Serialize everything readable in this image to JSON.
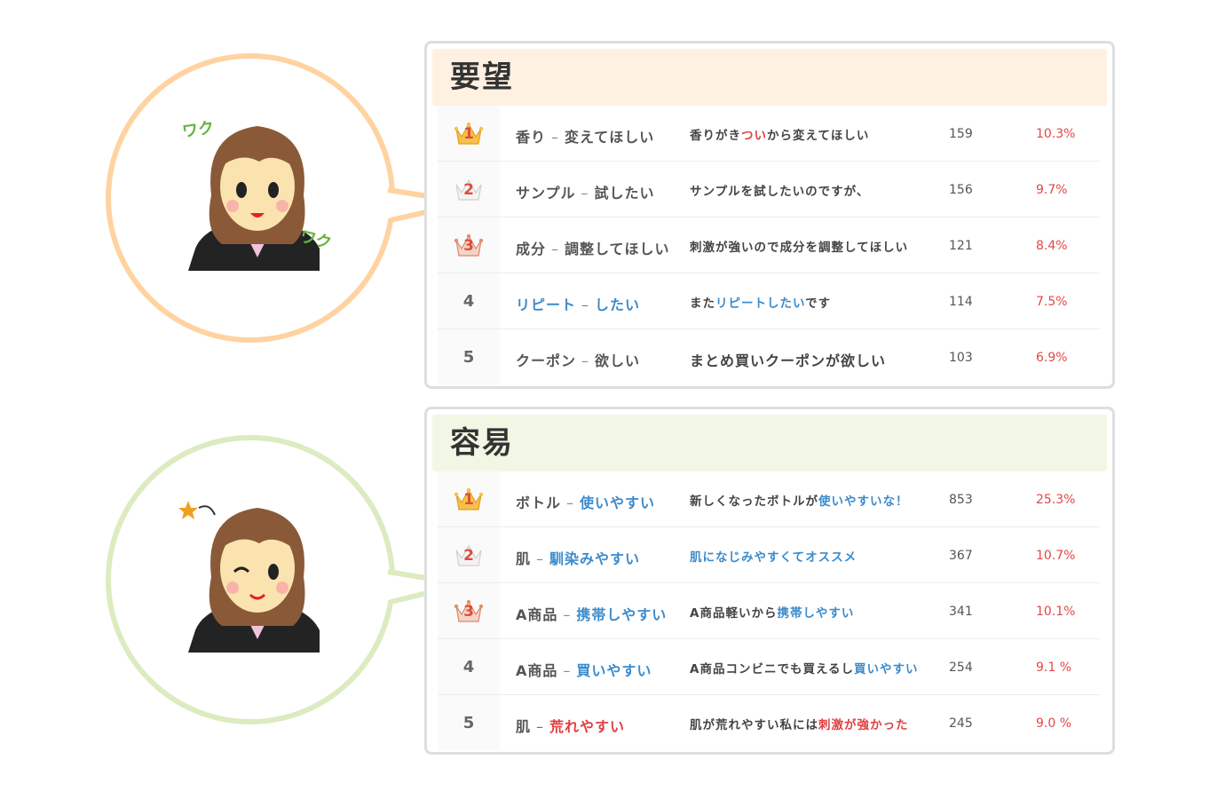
{
  "sections": [
    {
      "title": "要望",
      "accent": "#ffd3a1",
      "header_bg": "#fff1e1",
      "character_text_top": "ワク",
      "character_text_bottom": "ワク",
      "rows": [
        {
          "rank": "1",
          "keyword": "香り",
          "verb": "変えてほしい",
          "comment_pre": "香りがき",
          "comment_hl": "つい",
          "comment_post": "から変えてほしい",
          "count": "159",
          "percent": "10.3%"
        },
        {
          "rank": "2",
          "keyword": "サンプル",
          "verb": "試したい",
          "comment_pre": "サンプルを試したいのですが、",
          "comment_hl": "",
          "comment_post": "",
          "count": "156",
          "percent": "9.7%"
        },
        {
          "rank": "3",
          "keyword": "成分",
          "verb": "調整してほしい",
          "comment_pre": "刺激が強いので成分を調整してほしい",
          "comment_hl": "",
          "comment_post": "",
          "count": "121",
          "percent": "8.4%"
        },
        {
          "rank": "4",
          "keyword": "リピート",
          "verb": "したい",
          "comment_pre": "また",
          "comment_hl": "リピートしたい",
          "comment_post": "です",
          "count": "114",
          "percent": "7.5%"
        },
        {
          "rank": "5",
          "keyword": "クーポン",
          "verb": "欲しい",
          "comment_pre": "まとめ買いクーポンが欲しい",
          "comment_hl": "",
          "comment_post": "",
          "count": "103",
          "percent": "6.9%"
        }
      ]
    },
    {
      "title": "容易",
      "accent": "#dcebc0",
      "header_bg": "#f1f7e4",
      "rows": [
        {
          "rank": "1",
          "keyword": "ボトル",
          "verb": "使いやすい",
          "comment_pre": "新しくなったボトルが",
          "comment_hl": "使いやすいな！",
          "comment_post": "",
          "count": "853",
          "percent": "25.3%"
        },
        {
          "rank": "2",
          "keyword": "肌",
          "verb": "馴染みやすい",
          "comment_pre": "",
          "comment_hl": "肌になじみやすくてオススメ",
          "comment_post": "",
          "count": "367",
          "percent": "10.7%"
        },
        {
          "rank": "3",
          "keyword": "A商品",
          "verb": "携帯しやすい",
          "comment_pre": "A商品軽いから",
          "comment_hl": "携帯しやすい",
          "comment_post": "",
          "count": "341",
          "percent": "10.1%"
        },
        {
          "rank": "4",
          "keyword": "A商品",
          "verb": "買いやすい",
          "comment_pre": "A商品コンビニでも買えるし",
          "comment_hl": "買いやすい",
          "comment_post": "",
          "count": "254",
          "percent": "9.1 %"
        },
        {
          "rank": "5",
          "keyword": "肌",
          "verb": "荒れやすい",
          "comment_pre": "肌が荒れやすい私には",
          "comment_hl": "刺激が強かった",
          "comment_post": "",
          "count": "245",
          "percent": "9.0 %"
        }
      ]
    }
  ]
}
